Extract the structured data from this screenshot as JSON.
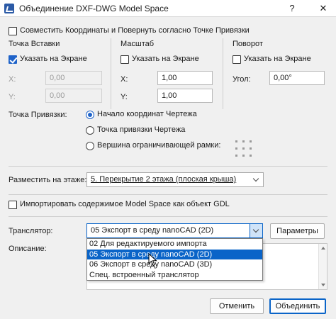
{
  "window": {
    "title": "Объединение DXF-DWG Model Space",
    "help": "?",
    "close": "✕"
  },
  "combine_checkbox": {
    "label": "Совместить Координаты и Повернуть согласно Точке Привязки",
    "checked": false
  },
  "insertion": {
    "heading": "Точка Вставки",
    "specify_label": "Указать на Экране",
    "specify_checked": true,
    "x_label": "X:",
    "x_value": "0,00",
    "y_label": "Y:",
    "y_value": "0,00"
  },
  "scale": {
    "heading": "Масштаб",
    "specify_label": "Указать на Экране",
    "specify_checked": false,
    "x_label": "X:",
    "x_value": "1,00",
    "y_label": "Y:",
    "y_value": "1,00"
  },
  "rotation": {
    "heading": "Поворот",
    "specify_label": "Указать на Экране",
    "specify_checked": false,
    "angle_label": "Угол:",
    "angle_value": "0,00°"
  },
  "anchor": {
    "label": "Точка Привязки:",
    "options": [
      {
        "label": "Начало координат Чертежа",
        "selected": true
      },
      {
        "label": "Точка привязки Чертежа",
        "selected": false
      },
      {
        "label": "Вершина ограничивающей рамки:",
        "selected": false
      }
    ]
  },
  "story": {
    "label": "Разместить на этаже:",
    "value": "5. Перекрытие 2 этажа (плоская крыша)"
  },
  "gdl_checkbox": {
    "label": "Импортировать содержимое Model Space как объект GDL",
    "checked": false
  },
  "translator": {
    "label": "Транслятор:",
    "value": "05 Экспорт в среду nanoCAD (2D)",
    "params_button": "Параметры",
    "options": [
      "02 Для редактируемого импорта",
      "05 Экспорт в среду nanoCAD (2D)",
      "06 Экспорт в среду nanoCAD (3D)",
      "Спец. встроенный транслятор"
    ],
    "highlighted_index": 1
  },
  "description": {
    "label": "Описание:"
  },
  "buttons": {
    "cancel": "Отменить",
    "ok": "Объединить"
  },
  "colors": {
    "accent": "#0a64c8",
    "checkbox": "#1f63c9",
    "background": "#f0f0f0"
  }
}
